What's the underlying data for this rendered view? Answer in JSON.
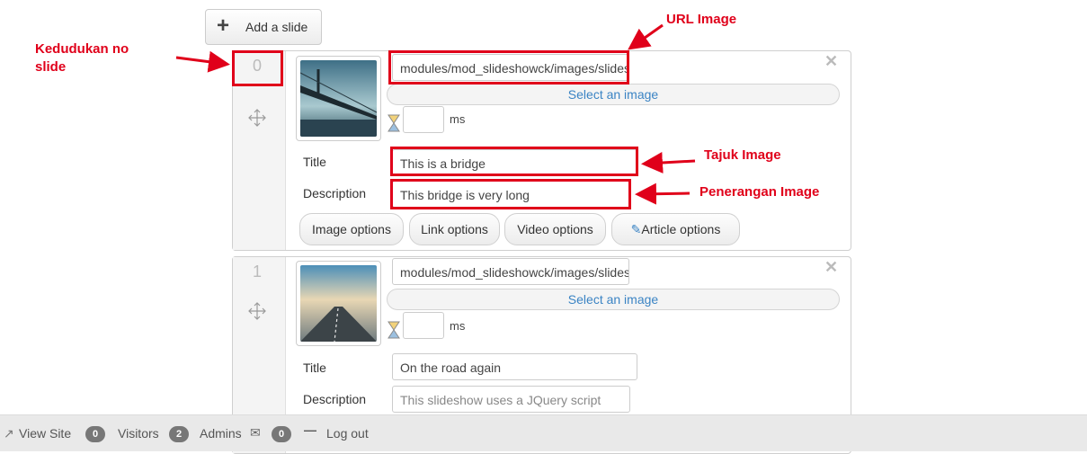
{
  "add_slide": {
    "label": "Add a slide"
  },
  "slides": [
    {
      "index": "0",
      "url": "modules/mod_slideshowck/images/slides/bridge.jpg",
      "select_label": "Select an image",
      "ms_unit": "ms",
      "title_label": "Title",
      "title_value": "This is a bridge",
      "description_label": "Description",
      "description_value": "This bridge is very long",
      "options": [
        "Image options",
        "Link options",
        "Video options",
        "Article options"
      ]
    },
    {
      "index": "1",
      "url": "modules/mod_slideshowck/images/slides/road.jpg",
      "select_label": "Select an image",
      "ms_unit": "ms",
      "title_label": "Title",
      "title_value": "On the road again",
      "description_label": "Description",
      "description_value": "This slideshow uses a JQuery script"
    }
  ],
  "annotations": {
    "url_image": "URL Image",
    "position": "Kedudukan no slide",
    "title": "Tajuk Image",
    "description": "Penerangan Image"
  },
  "footer": {
    "view_site": "View Site",
    "visitors_count": "0",
    "visitors_label": "Visitors",
    "admins_count": "2",
    "admins_label": "Admins",
    "messages_count": "0",
    "logout": "Log out"
  },
  "colors": {
    "annotation": "#e0001a",
    "link_blue": "#3b84c4"
  }
}
